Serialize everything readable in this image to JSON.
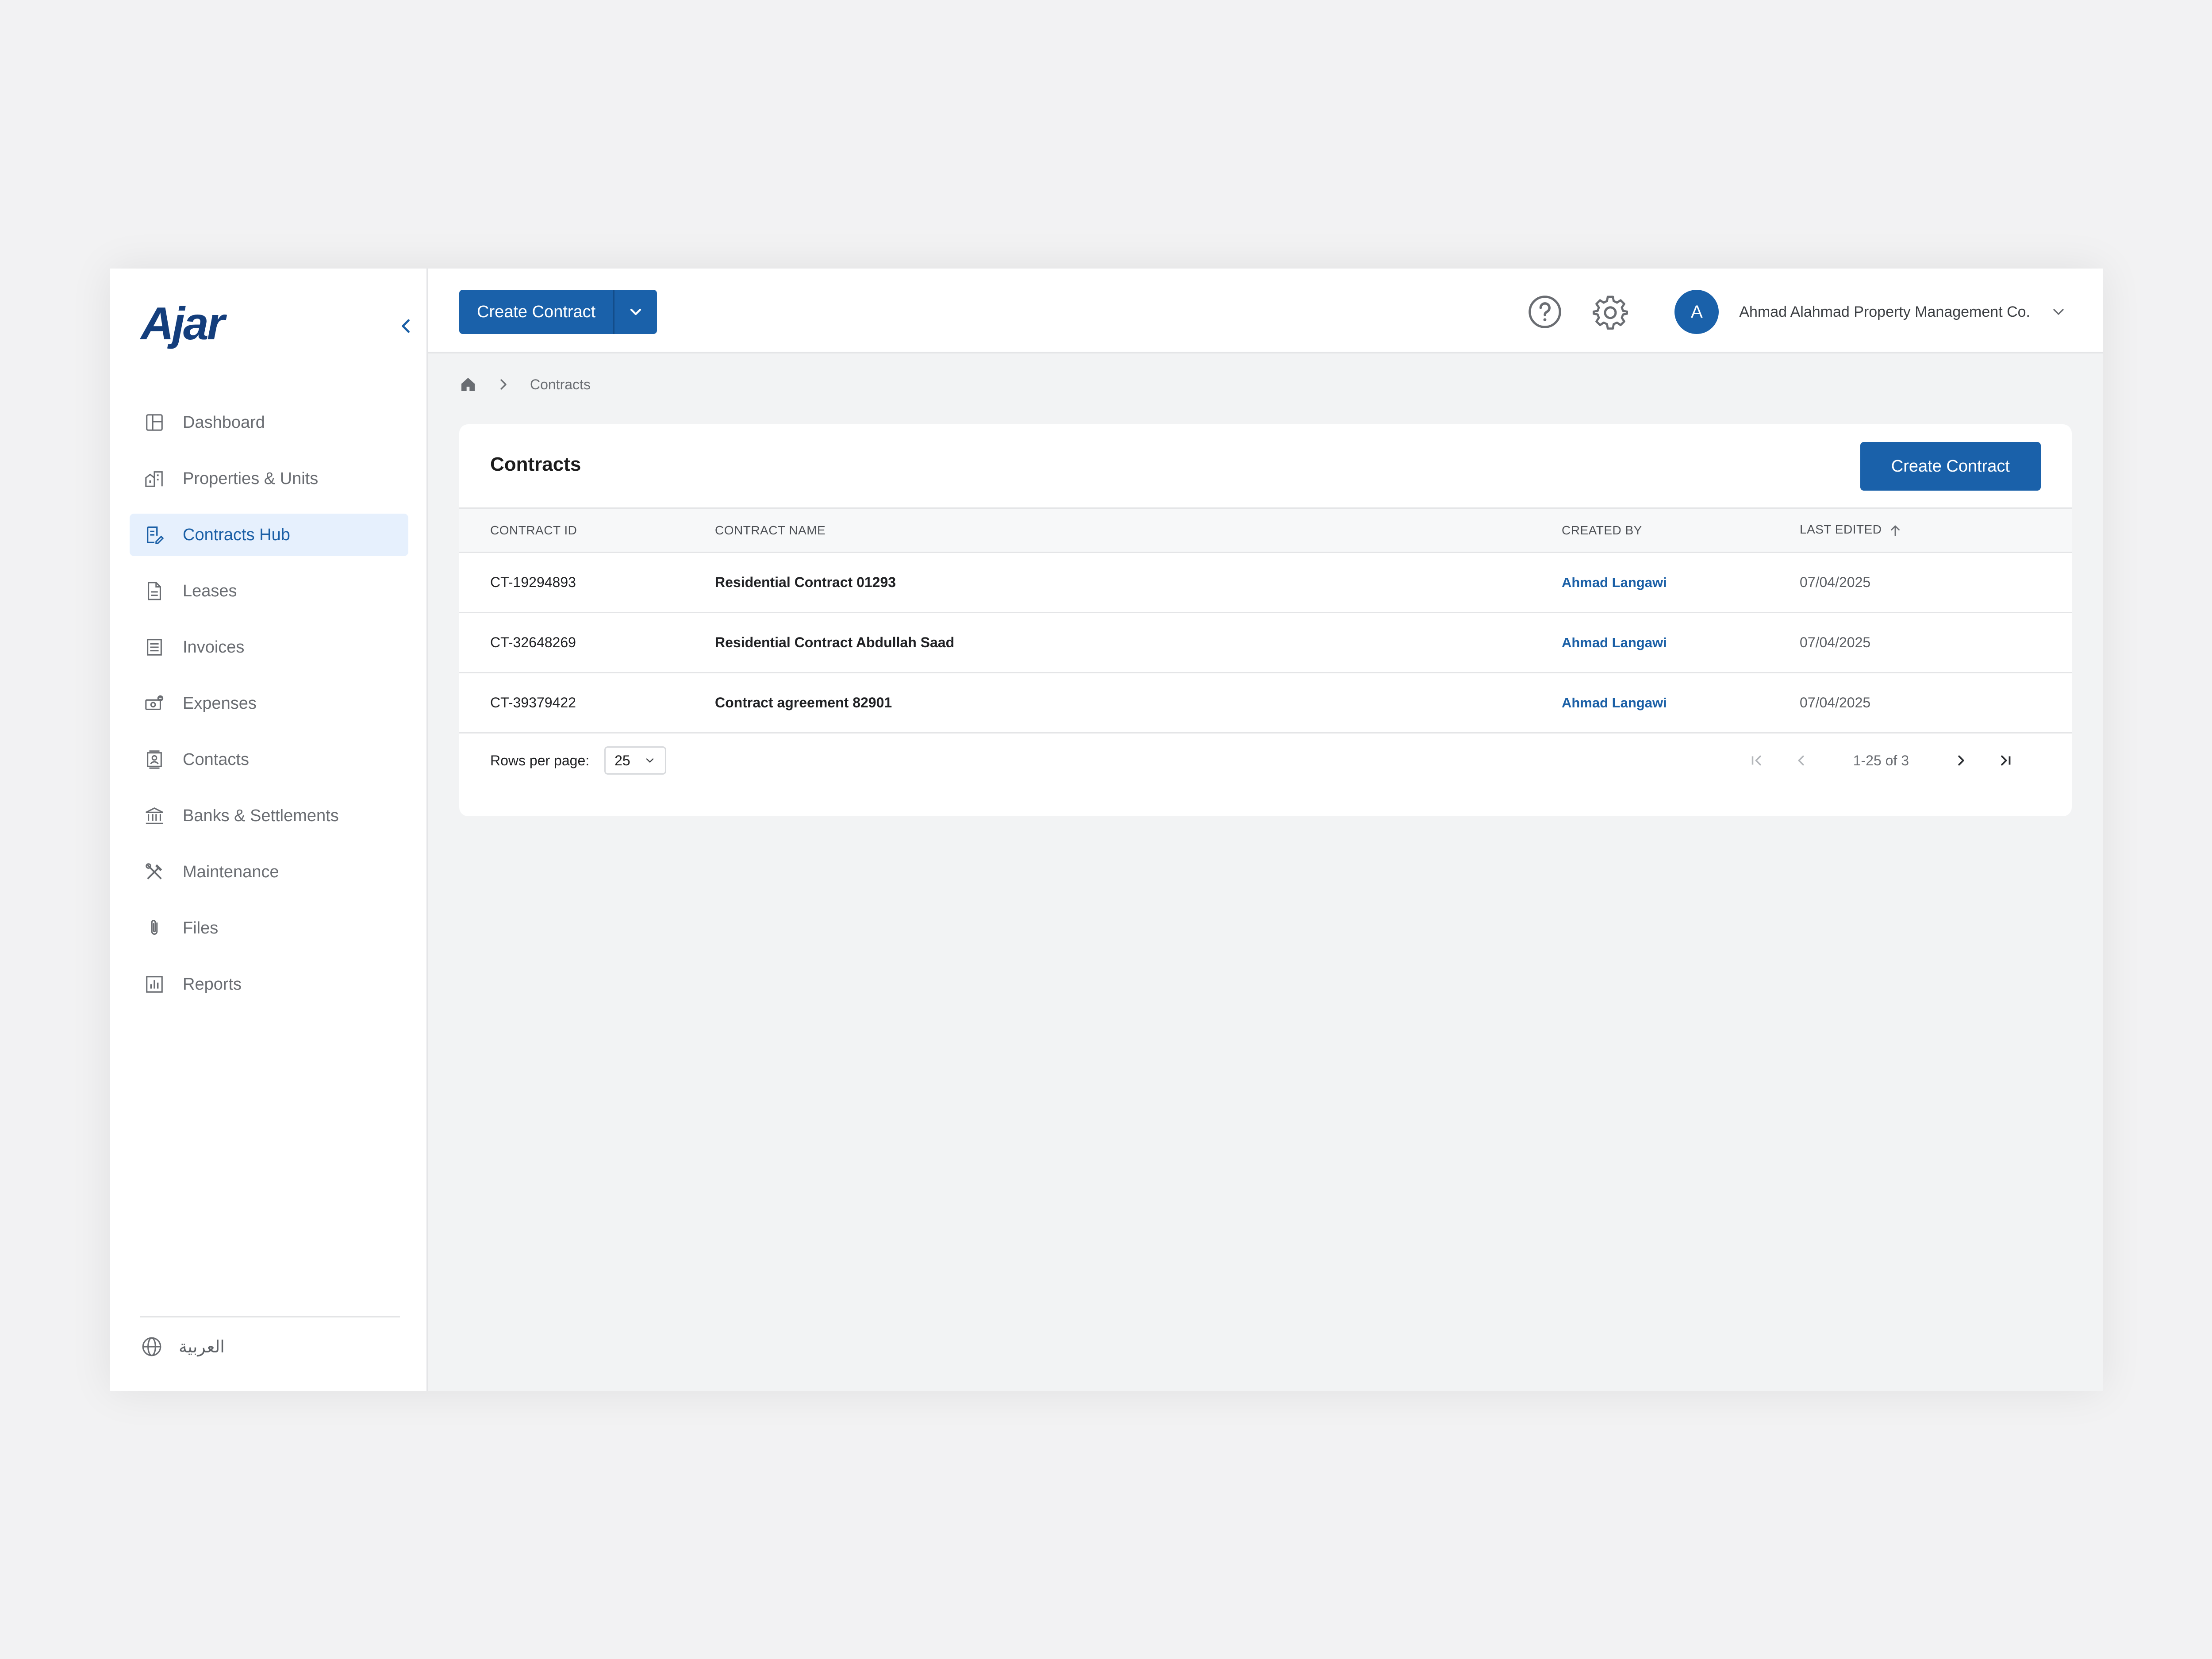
{
  "app": {
    "logo": "Ajar"
  },
  "sidebar": {
    "items": [
      {
        "label": "Dashboard",
        "icon": "dashboard-icon"
      },
      {
        "label": "Properties & Units",
        "icon": "buildings-icon"
      },
      {
        "label": "Contracts Hub",
        "icon": "contract-icon",
        "active": true
      },
      {
        "label": "Leases",
        "icon": "document-icon"
      },
      {
        "label": "Invoices",
        "icon": "invoice-icon"
      },
      {
        "label": "Expenses",
        "icon": "cash-icon"
      },
      {
        "label": "Contacts",
        "icon": "contacts-icon"
      },
      {
        "label": "Banks & Settlements",
        "icon": "bank-icon"
      },
      {
        "label": "Maintenance",
        "icon": "tools-icon"
      },
      {
        "label": "Files",
        "icon": "paperclip-icon"
      },
      {
        "label": "Reports",
        "icon": "chart-icon"
      }
    ],
    "language": "العربية"
  },
  "topbar": {
    "create_label": "Create Contract",
    "avatar_initial": "A",
    "org_name": "Ahmad Alahmad Property Management Co."
  },
  "breadcrumb": {
    "current": "Contracts"
  },
  "card": {
    "title": "Contracts",
    "create_label": "Create Contract",
    "columns": [
      "CONTRACT ID",
      "CONTRACT NAME",
      "CREATED BY",
      "LAST EDITED"
    ],
    "rows": [
      {
        "id": "CT-19294893",
        "name": "Residential Contract 01293",
        "created_by": "Ahmad Langawi",
        "last_edited": "07/04/2025"
      },
      {
        "id": "CT-32648269",
        "name": "Residential Contract Abdullah Saad",
        "created_by": "Ahmad Langawi",
        "last_edited": "07/04/2025"
      },
      {
        "id": "CT-39379422",
        "name": "Contract agreement 82901",
        "created_by": "Ahmad Langawi",
        "last_edited": "07/04/2025"
      }
    ],
    "footer": {
      "rows_label": "Rows per page:",
      "rows_value": "25",
      "range": "1-25 of 3"
    }
  },
  "colors": {
    "primary": "#1a61aa",
    "active_bg": "#e6f0fd",
    "logo": "#143e7c"
  }
}
